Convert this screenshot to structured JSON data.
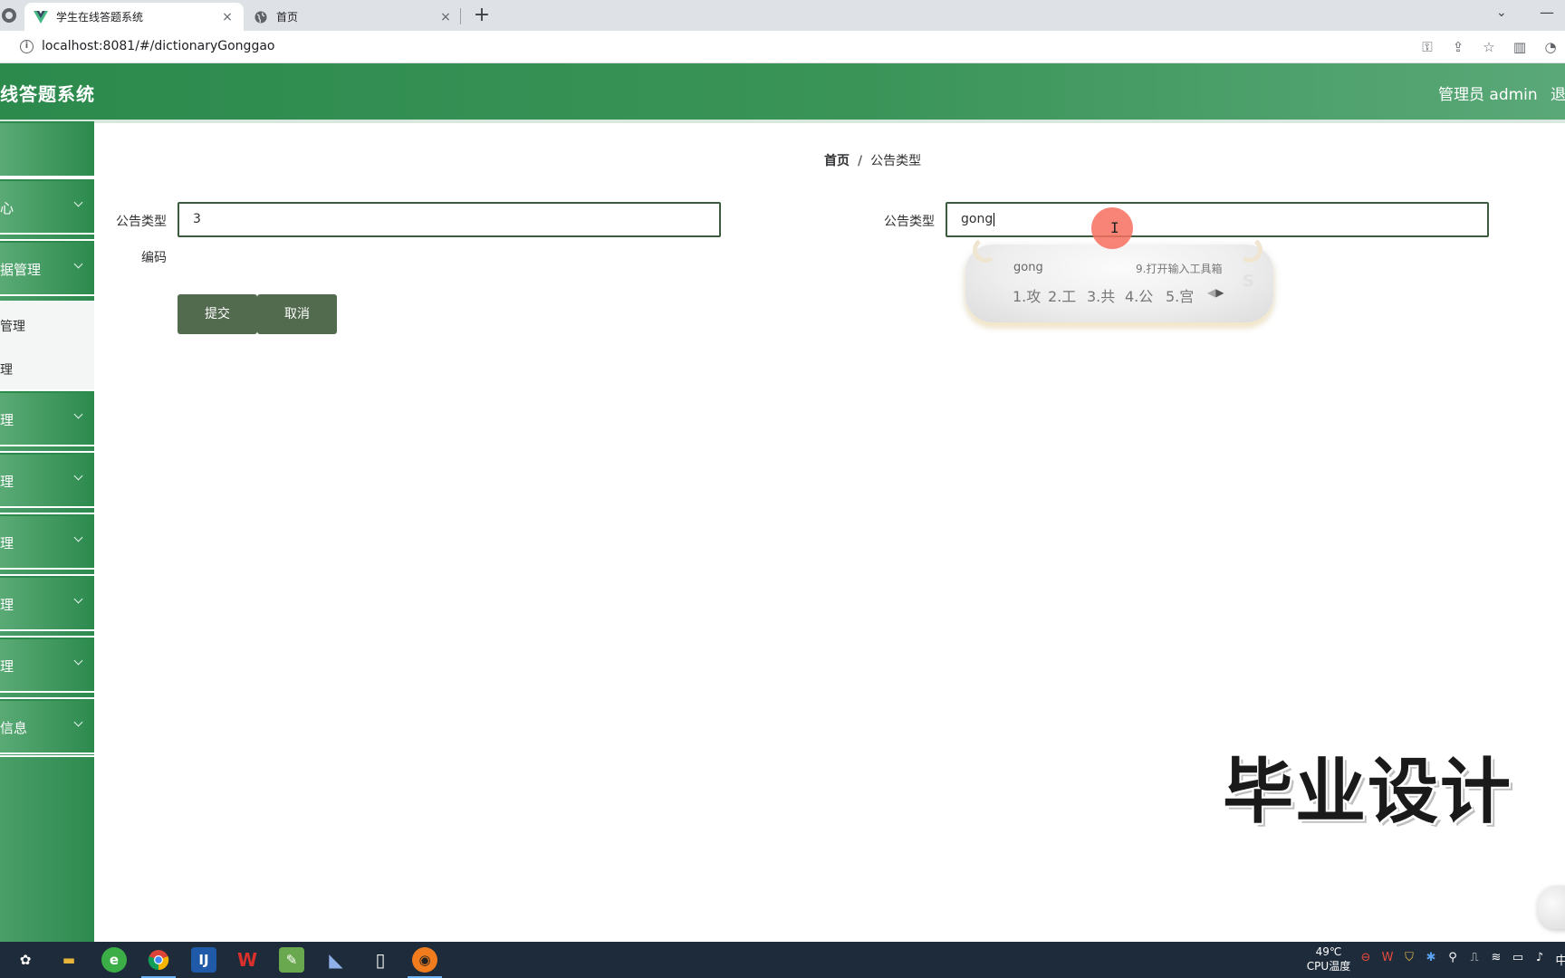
{
  "browser": {
    "tabs": [
      {
        "title": "学生在线答题系统",
        "active": true,
        "favicon": "vue-logo-icon"
      },
      {
        "title": "首页",
        "active": false,
        "favicon": "globe-icon"
      }
    ],
    "close_glyph": "×",
    "new_tab_glyph": "+",
    "dropdown_glyph": "⌄",
    "minimize_glyph": "—",
    "url": "localhost:8081/#/dictionaryGonggao"
  },
  "header": {
    "title": "线答题系统",
    "admin": "管理员 admin",
    "logout": "退",
    "colors": {
      "primary": "#2c8a4d",
      "accent": "#5aa878"
    }
  },
  "sidebar": {
    "groups": [
      {
        "label": ""
      },
      {
        "label": "心"
      },
      {
        "label": "据管理"
      },
      {
        "label": "理"
      },
      {
        "label": "理"
      },
      {
        "label": "理"
      },
      {
        "label": "理"
      },
      {
        "label": "理"
      },
      {
        "label": "信息"
      }
    ],
    "submenu": [
      {
        "label": "管理"
      },
      {
        "label": "理"
      }
    ]
  },
  "breadcrumb": {
    "home": "首页",
    "separator": "/",
    "current": "公告类型"
  },
  "form": {
    "code_label_line1": "公告类型",
    "code_label_line2": "编码",
    "code_value": "3",
    "name_label": "公告类型",
    "name_value": "gong",
    "submit": "提交",
    "cancel": "取消",
    "button_color": "#526b4e"
  },
  "ime": {
    "pinyin": "gong",
    "toolbox": "9.打开输入工具箱",
    "candidates": [
      "1.攻",
      "2.工",
      "3.共",
      "4.公",
      "5.宫"
    ],
    "logo": "S"
  },
  "watermark": "毕业设计",
  "taskbar": {
    "apps": [
      {
        "name": "system-start-icon",
        "glyph": "✿",
        "color": "#5b7fa6"
      },
      {
        "name": "file-explorer-icon",
        "glyph": "▬",
        "color": "#e7b63a"
      },
      {
        "name": "browser-green-icon",
        "glyph": "e",
        "color": "#3cae47"
      },
      {
        "name": "chrome-icon",
        "glyph": "●",
        "color": "#4285f4"
      },
      {
        "name": "ide-icon",
        "glyph": "IJ",
        "color": "#1e5aa8"
      },
      {
        "name": "wps-icon",
        "glyph": "W",
        "color": "#d9302c"
      },
      {
        "name": "notepad-plus-icon",
        "glyph": "✎",
        "color": "#6aa84f"
      },
      {
        "name": "mysql-dolphin-icon",
        "glyph": "◣",
        "color": "#5c7cb8"
      },
      {
        "name": "text-file-icon",
        "glyph": "▯",
        "color": "#e8e8e8"
      },
      {
        "name": "recorder-icon",
        "glyph": "◉",
        "color": "#f07c1e"
      }
    ],
    "temperature": "49℃",
    "temperature_label": "CPU温度",
    "tray": [
      "⊖",
      "W",
      "⛉",
      "✱",
      "⚲",
      "⎍",
      "≋",
      "▭",
      "♪"
    ],
    "ime_indicator": "中"
  }
}
